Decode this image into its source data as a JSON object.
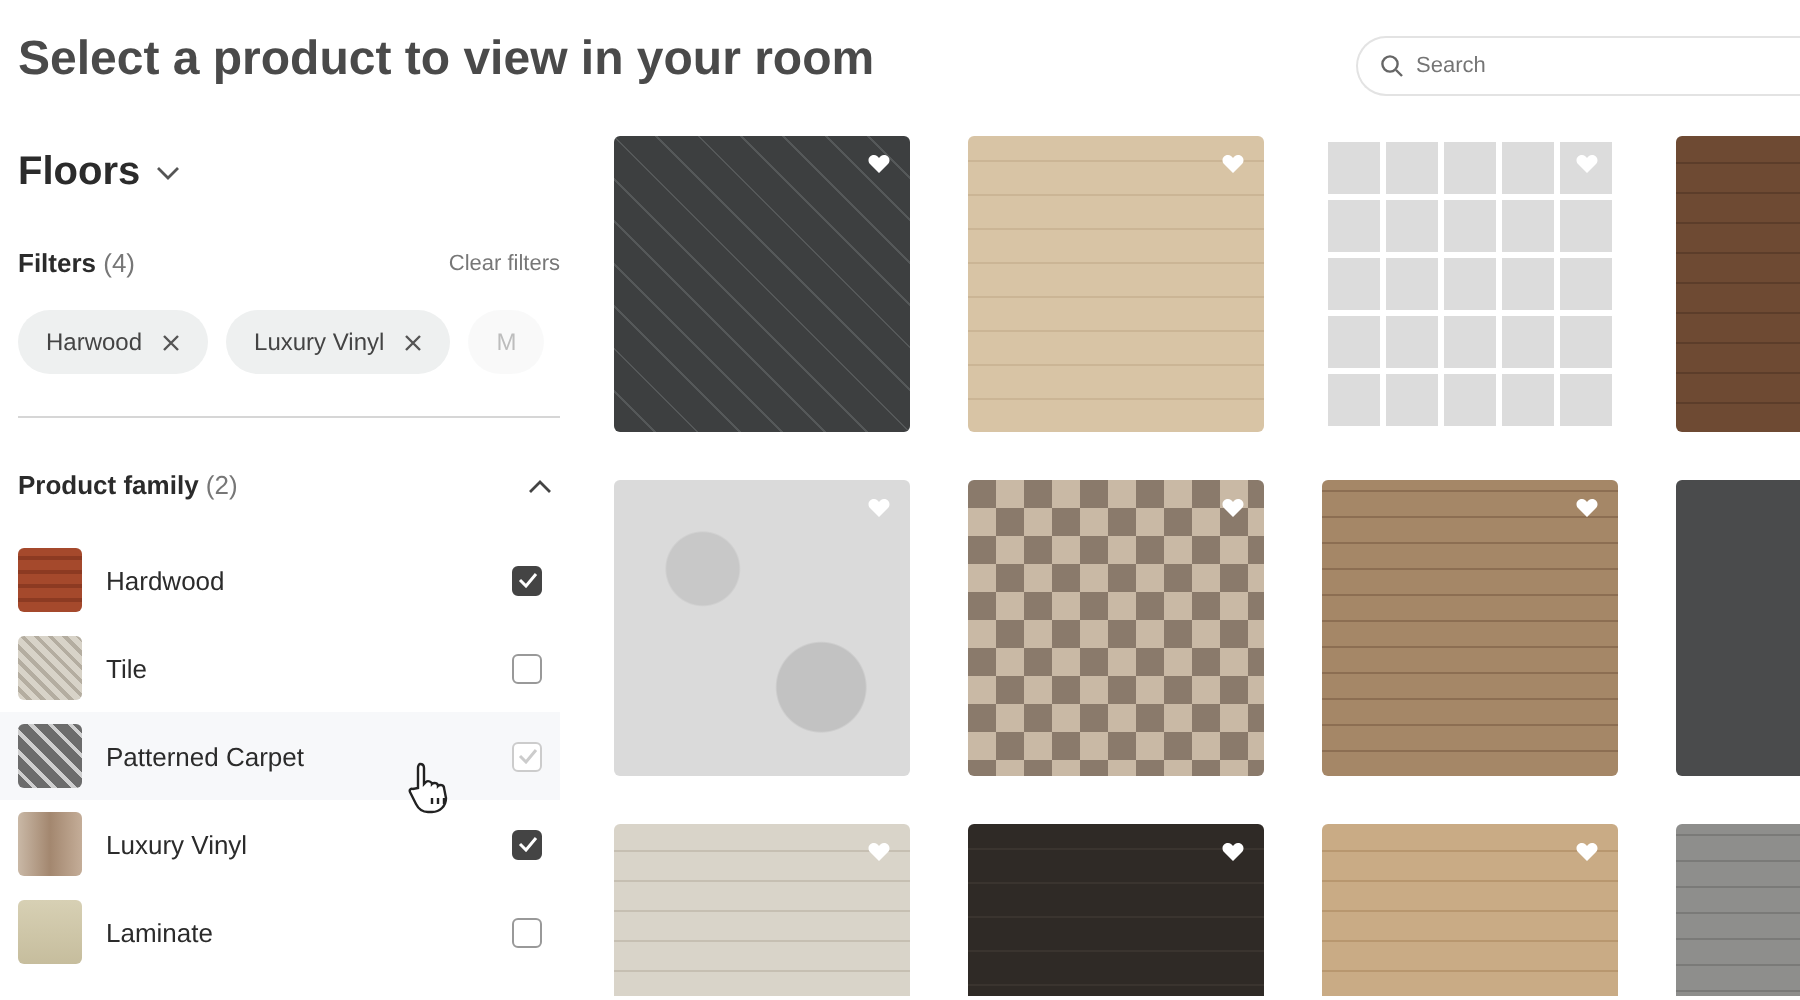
{
  "title": "Select a product to view in your room",
  "search": {
    "placeholder": "Search"
  },
  "category": {
    "label": "Floors"
  },
  "filters": {
    "label": "Filters",
    "count": "(4)",
    "clear": "Clear filters",
    "chips": [
      {
        "label": "Harwood",
        "removable": true
      },
      {
        "label": "Luxury Vinyl",
        "removable": true
      },
      {
        "label": "M",
        "removable": false
      }
    ]
  },
  "product_family": {
    "label": "Product family",
    "count": "(2)",
    "expanded": true,
    "items": [
      {
        "name": "Hardwood",
        "kind": "redwood",
        "checked": true,
        "hovered": false
      },
      {
        "name": "Tile",
        "kind": "mosaic",
        "checked": false,
        "hovered": false
      },
      {
        "name": "Patterned Carpet",
        "kind": "lattice",
        "checked": false,
        "hovered": true
      },
      {
        "name": "Luxury Vinyl",
        "kind": "vinyl",
        "checked": true,
        "hovered": false
      },
      {
        "name": "Laminate",
        "kind": "laminate",
        "checked": false,
        "hovered": false
      }
    ]
  },
  "products": [
    {
      "kind": "herringbone"
    },
    {
      "kind": "lightwood"
    },
    {
      "kind": "gridtile"
    },
    {
      "kind": "darkwood"
    },
    {
      "kind": "damask"
    },
    {
      "kind": "patterntile"
    },
    {
      "kind": "brownwood"
    },
    {
      "kind": "charcoal"
    },
    {
      "kind": "whitewash"
    },
    {
      "kind": "darkplank"
    },
    {
      "kind": "oak"
    },
    {
      "kind": "greywood"
    }
  ]
}
